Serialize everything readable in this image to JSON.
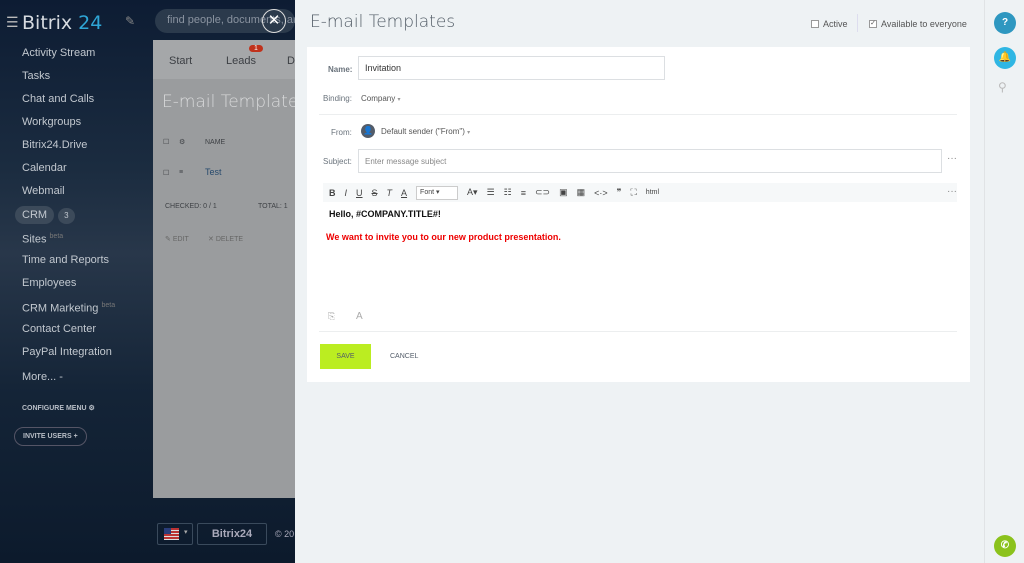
{
  "app": {
    "logo_a": "Bitrix",
    "logo_b": "24",
    "search_placeholder": "find people, documents, and mo"
  },
  "sidebar": {
    "items": [
      "Activity Stream",
      "Tasks",
      "Chat and Calls",
      "Workgroups",
      "Bitrix24.Drive",
      "Calendar",
      "Webmail"
    ],
    "crm": "CRM",
    "crm_count": "3",
    "sites": "Sites",
    "beta": "beta",
    "items2": [
      "Time and Reports",
      "Employees"
    ],
    "crm_marketing": "CRM Marketing",
    "items3": [
      "Contact Center",
      "PayPal Integration",
      "More... -"
    ],
    "configure": "CONFIGURE MENU",
    "invite": "INVITE USERS +"
  },
  "background": {
    "tabs": [
      "Start",
      "Leads",
      "D"
    ],
    "leads_badge": "1",
    "title": "E-mail Templates",
    "col_name": "NAME",
    "row": "Test",
    "checked": "CHECKED: 0 / 1",
    "total": "TOTAL: 1",
    "edit": "EDIT",
    "delete": "DELETE",
    "brand": "Bitrix24",
    "copyright": "© 20"
  },
  "panel": {
    "title": "E-mail Templates",
    "active": "Active",
    "active_checked": false,
    "available": "Available to everyone",
    "available_checked": true,
    "name_label": "Name:",
    "name_value": "Invitation",
    "binding_label": "Binding:",
    "binding_value": "Company",
    "from_label": "From:",
    "from_value": "Default sender (\"From\")",
    "subject_label": "Subject:",
    "subject_placeholder": "Enter message subject",
    "font_select": "Font",
    "html_label": "html",
    "body_line1": "Hello, #COMPANY.TITLE#!",
    "body_line2": "We want to invite you to our new product presentation.",
    "body_line2_color": "#ff0000",
    "save": "SAVE",
    "cancel": "CANCEL",
    "save_color": "#bbed21"
  }
}
